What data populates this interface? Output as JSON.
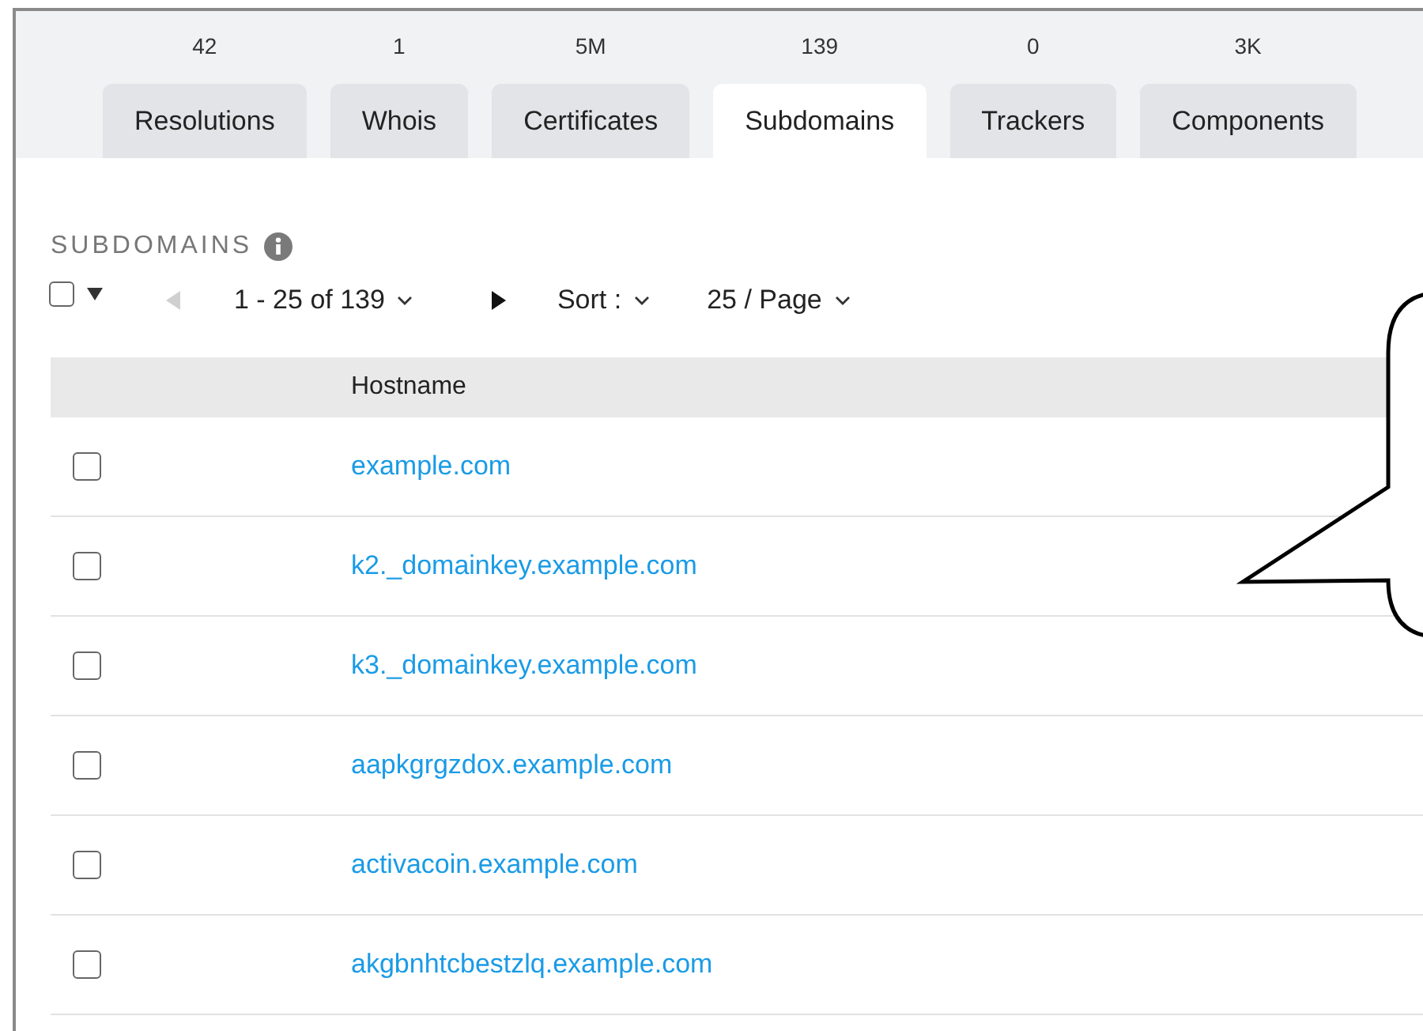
{
  "tabs": [
    {
      "count": "42",
      "label": "Resolutions",
      "selected": false
    },
    {
      "count": "1",
      "label": "Whois",
      "selected": false
    },
    {
      "count": "5M",
      "label": "Certificates",
      "selected": false
    },
    {
      "count": "139",
      "label": "Subdomains",
      "selected": true
    },
    {
      "count": "0",
      "label": "Trackers",
      "selected": false
    },
    {
      "count": "3K",
      "label": "Components",
      "selected": false
    }
  ],
  "section": {
    "title": "SUBDOMAINS"
  },
  "toolbar": {
    "select_all_checked": false,
    "prev_disabled": true,
    "next_disabled": false,
    "range": "1 - 25 of 139",
    "sort": "Sort :",
    "page_size": "25 / Page"
  },
  "table": {
    "columns": [
      "Hostname"
    ],
    "rows": [
      {
        "hostname": "example.com",
        "checked": false
      },
      {
        "hostname": "k2._domainkey.example.com",
        "checked": false
      },
      {
        "hostname": "k3._domainkey.example.com",
        "checked": false
      },
      {
        "hostname": "aapkgrgzdox.example.com",
        "checked": false
      },
      {
        "hostname": "activacoin.example.com",
        "checked": false
      },
      {
        "hostname": "akgbnhtcbestzlq.example.com",
        "checked": false
      }
    ]
  }
}
